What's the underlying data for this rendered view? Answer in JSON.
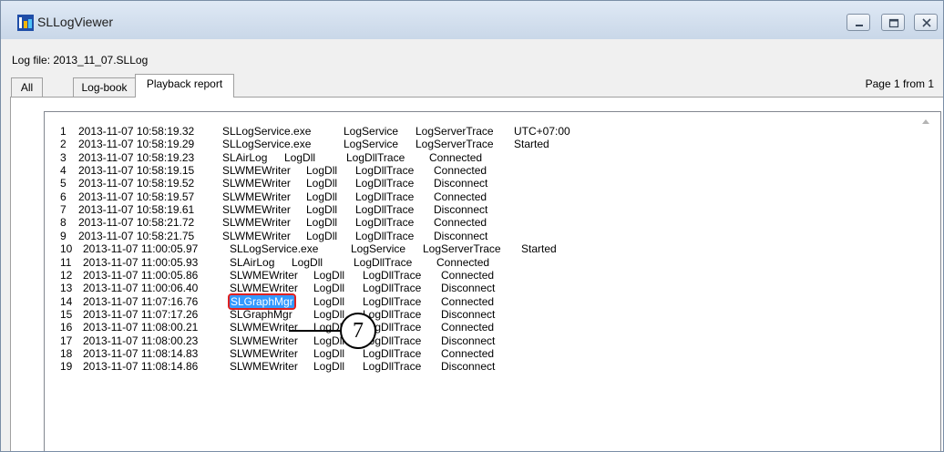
{
  "window": {
    "title": "SLLogViewer",
    "icon": "log-icon"
  },
  "log_file": "Log file: 2013_11_07.SLLog",
  "tabs": [
    {
      "label": "All"
    },
    {
      "label": "Log-book"
    },
    {
      "label": "Playback report"
    }
  ],
  "active_tab": "Playback report",
  "page_info": "Page 1 from 1",
  "callout": "7",
  "log_rows": [
    {
      "n": "1",
      "time": "2013-11-07 10:58:19.32",
      "src": "SLLogService.exe",
      "mod": "LogService",
      "trace": "LogServerTrace",
      "msg": "UTC+07:00"
    },
    {
      "n": "2",
      "time": "2013-11-07 10:58:19.29",
      "src": "SLLogService.exe",
      "mod": "LogService",
      "trace": "LogServerTrace",
      "msg": "Started"
    },
    {
      "n": "3",
      "time": "2013-11-07 10:58:19.23",
      "src": "SLAirLog",
      "mod": "LogDll",
      "trace": "LogDllTrace",
      "msg": "Connected"
    },
    {
      "n": "4",
      "time": "2013-11-07 10:58:19.15",
      "src": "SLWMEWriter",
      "mod": "LogDll",
      "trace": "LogDllTrace",
      "msg": "Connected"
    },
    {
      "n": "5",
      "time": "2013-11-07 10:58:19.52",
      "src": "SLWMEWriter",
      "mod": "LogDll",
      "trace": "LogDllTrace",
      "msg": "Disconnect"
    },
    {
      "n": "6",
      "time": "2013-11-07 10:58:19.57",
      "src": "SLWMEWriter",
      "mod": "LogDll",
      "trace": "LogDllTrace",
      "msg": "Connected"
    },
    {
      "n": "7",
      "time": "2013-11-07 10:58:19.61",
      "src": "SLWMEWriter",
      "mod": "LogDll",
      "trace": "LogDllTrace",
      "msg": "Disconnect"
    },
    {
      "n": "8",
      "time": "2013-11-07 10:58:21.72",
      "src": "SLWMEWriter",
      "mod": "LogDll",
      "trace": "LogDllTrace",
      "msg": "Connected"
    },
    {
      "n": "9",
      "time": "2013-11-07 10:58:21.75",
      "src": "SLWMEWriter",
      "mod": "LogDll",
      "trace": "LogDllTrace",
      "msg": "Disconnect"
    },
    {
      "n": "10",
      "time": "2013-11-07 11:00:05.97",
      "src": "SLLogService.exe",
      "mod": "LogService",
      "trace": "LogServerTrace",
      "msg": "Started"
    },
    {
      "n": "11",
      "time": "2013-11-07 11:00:05.93",
      "src": "SLAirLog",
      "mod": "LogDll",
      "trace": "LogDllTrace",
      "msg": "Connected"
    },
    {
      "n": "12",
      "time": "2013-11-07 11:00:05.86",
      "src": "SLWMEWriter",
      "mod": "LogDll",
      "trace": "LogDllTrace",
      "msg": "Connected"
    },
    {
      "n": "13",
      "time": "2013-11-07 11:00:06.40",
      "src": "SLWMEWriter",
      "mod": "LogDll",
      "trace": "LogDllTrace",
      "msg": "Disconnect"
    },
    {
      "n": "14",
      "time": "2013-11-07 11:07:16.76",
      "src": "SLGraphMgr",
      "mod": "LogDll",
      "trace": "LogDllTrace",
      "msg": "Connected",
      "selected": true
    },
    {
      "n": "15",
      "time": "2013-11-07 11:07:17.26",
      "src": "SLGraphMgr",
      "mod": "LogDll",
      "trace": "LogDllTrace",
      "msg": "Disconnect"
    },
    {
      "n": "16",
      "time": "2013-11-07 11:08:00.21",
      "src": "SLWMEWriter",
      "mod": "LogDll",
      "trace": "LogDllTrace",
      "msg": "Connected"
    },
    {
      "n": "17",
      "time": "2013-11-07 11:08:00.23",
      "src": "SLWMEWriter",
      "mod": "LogDll",
      "trace": "LogDllTrace",
      "msg": "Disconnect"
    },
    {
      "n": "18",
      "time": "2013-11-07 11:08:14.83",
      "src": "SLWMEWriter",
      "mod": "LogDll",
      "trace": "LogDllTrace",
      "msg": "Connected"
    },
    {
      "n": "19",
      "time": "2013-11-07 11:08:14.86",
      "src": "SLWMEWriter",
      "mod": "LogDll",
      "trace": "LogDllTrace",
      "msg": "Disconnect"
    }
  ]
}
